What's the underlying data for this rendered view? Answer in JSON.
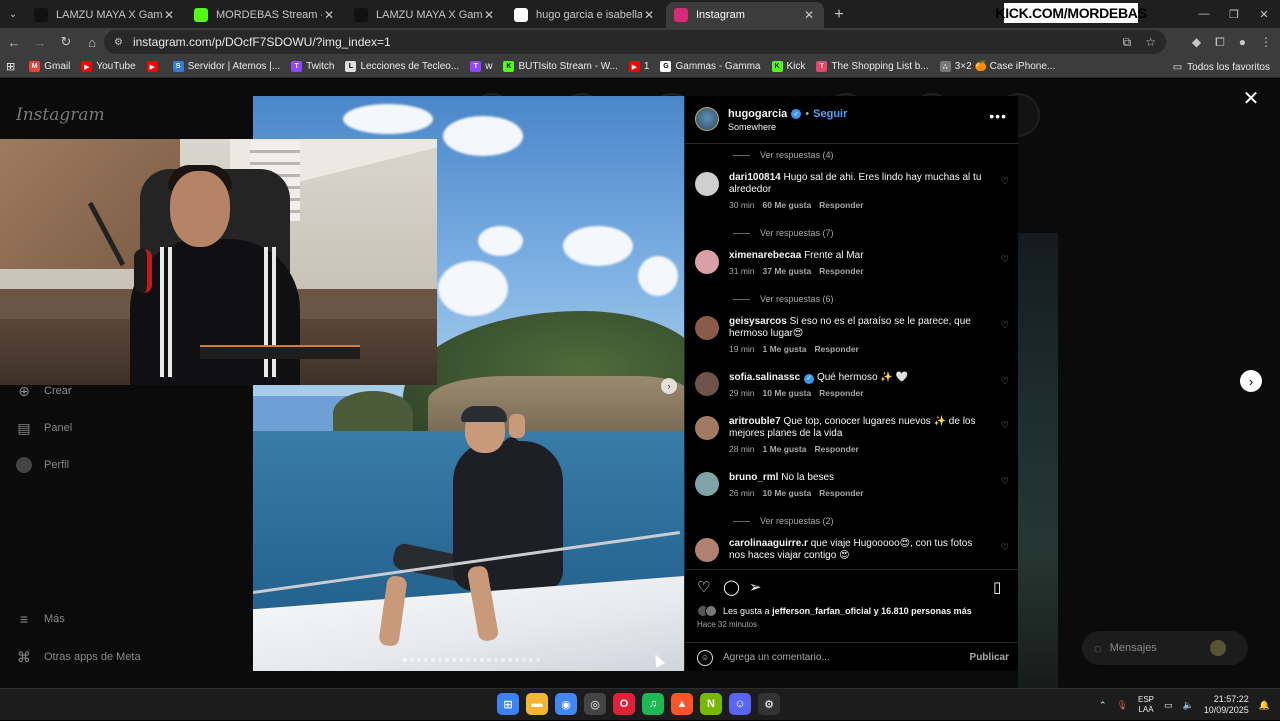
{
  "browser": {
    "tabs": [
      {
        "title": "LAMZU MAYA X Gaming Mous",
        "favicon": "tiktok-icon",
        "color": "#111111",
        "active": false
      },
      {
        "title": "MORDEBAS Stream - Watch Li",
        "favicon": "kick-icon",
        "color": "#53fc18",
        "active": false
      },
      {
        "title": "LAMZU MAYA X Gaming Mous",
        "favicon": "tiktok-icon",
        "color": "#111111",
        "active": false
      },
      {
        "title": "hugo garcia e isabella ladera - B",
        "favicon": "google-icon",
        "color": "#ffffff",
        "active": false
      },
      {
        "title": "Instagram",
        "favicon": "instagram-icon",
        "color": "#d62976",
        "active": true
      }
    ],
    "kick_overlay": "KICK.COM/MORDEBAS",
    "url": "instagram.com/p/DOcfF7SDOWU/?img_index=1",
    "bookmarks": [
      {
        "label": "Gmail",
        "color": "#ea4335",
        "glyph": "M"
      },
      {
        "label": "YouTube",
        "color": "#ff0000",
        "glyph": "▶"
      },
      {
        "label": "",
        "color": "#ff0000",
        "glyph": "▶"
      },
      {
        "label": "Servidor | Atemos |...",
        "color": "#2f7fd6",
        "glyph": "S"
      },
      {
        "label": "Twitch",
        "color": "#9146ff",
        "glyph": "T"
      },
      {
        "label": "Lecciones de Tecleo...",
        "color": "#dddddd",
        "glyph": "L"
      },
      {
        "label": "w",
        "color": "#9146ff",
        "glyph": "T"
      },
      {
        "label": "BUTIsito Stream - W...",
        "color": "#53fc18",
        "glyph": "K"
      },
      {
        "label": "1",
        "color": "#ff0000",
        "glyph": "▶"
      },
      {
        "label": "Gammas - Gamma",
        "color": "#ffffff",
        "glyph": "G"
      },
      {
        "label": "Kick",
        "color": "#53fc18",
        "glyph": "K"
      },
      {
        "label": "The Shopping List b...",
        "color": "#e8456b",
        "glyph": "T"
      },
      {
        "label": "3×2 🍊 Case iPhone...",
        "color": "#777777",
        "glyph": "∴"
      }
    ],
    "all_bookmarks": "Todos los favoritos"
  },
  "instagram": {
    "logo": "Instagram",
    "sidebar": [
      {
        "label": "Crear",
        "icon": "plus-icon",
        "glyph": "⊕"
      },
      {
        "label": "Panel",
        "icon": "chart-icon",
        "glyph": "▤"
      },
      {
        "label": "Perfil",
        "icon": "profile-icon",
        "glyph": "●"
      },
      {
        "label": "Más",
        "icon": "menu-icon",
        "glyph": "≡"
      },
      {
        "label": "Otras apps de Meta",
        "icon": "meta-icon",
        "glyph": "⌘"
      }
    ],
    "messages": "Mensajes",
    "post": {
      "username": "hugogarcia",
      "follow": "Seguir",
      "location": "Somewhere",
      "likes_prefix": "Les gusta a",
      "likes_user": "jefferson_farfan_oficial",
      "likes_conj": "y",
      "likes_count": "16.810 personas más",
      "posted": "Hace 32 minutos",
      "comment_placeholder": "Agrega un comentario...",
      "publish": "Publicar",
      "carousel_index": 1,
      "carousel_total": 20
    },
    "comments": [
      {
        "type": "replies",
        "text": "Ver respuestas (4)"
      },
      {
        "type": "comment",
        "user": "dari100814",
        "text": "Hugo sal de ahi. Eres lindo hay muchas al tu alrededor",
        "time": "30 min",
        "likes": "60 Me gusta",
        "reply": "Responder",
        "avatar": "#cfcfcf"
      },
      {
        "type": "replies",
        "text": "Ver respuestas (7)"
      },
      {
        "type": "comment",
        "user": "ximenarebecaa",
        "text": "Frente al Mar",
        "time": "31 min",
        "likes": "37 Me gusta",
        "reply": "Responder",
        "avatar": "#d9a0a8"
      },
      {
        "type": "replies",
        "text": "Ver respuestas (6)"
      },
      {
        "type": "comment",
        "user": "geisysarcos",
        "text": "Si eso no es el paraíso se le parece, que hermoso lugar😍",
        "time": "19 min",
        "likes": "1 Me gusta",
        "reply": "Responder",
        "avatar": "#8a5a4a"
      },
      {
        "type": "comment",
        "user": "sofia.salinassc",
        "text": "Qué hermoso ✨ 🤍",
        "time": "29 min",
        "likes": "10 Me gusta",
        "reply": "Responder",
        "avatar": "#6e5448",
        "verified": true
      },
      {
        "type": "comment",
        "user": "aritrouble7",
        "text": "Que top, conocer lugares nuevos ✨ de los mejores planes de la vida",
        "time": "28 min",
        "likes": "1 Me gusta",
        "reply": "Responder",
        "avatar": "#a27a62"
      },
      {
        "type": "comment",
        "user": "bruno_rml",
        "text": "No la beses",
        "time": "26 min",
        "likes": "10 Me gusta",
        "reply": "Responder",
        "avatar": "#7fa4a8"
      },
      {
        "type": "replies",
        "text": "Ver respuestas (2)"
      },
      {
        "type": "comment",
        "user": "carolinaaguirre.r",
        "text": "que viaje Hugooooo😍, con tus fotos nos haces viajar contigo 😍",
        "time": "",
        "likes": "",
        "reply": "",
        "avatar": "#b08070"
      }
    ]
  },
  "taskbar": {
    "apps": [
      {
        "name": "windows-start-icon",
        "glyph": "⊞",
        "color": "#3b82f6"
      },
      {
        "name": "file-explorer-icon",
        "glyph": "▬",
        "color": "#f2b632"
      },
      {
        "name": "chrome-icon",
        "glyph": "◉",
        "color": "#4285f4"
      },
      {
        "name": "obs-icon",
        "glyph": "◎",
        "color": "#444444"
      },
      {
        "name": "opera-icon",
        "glyph": "O",
        "color": "#e1203a"
      },
      {
        "name": "spotify-icon",
        "glyph": "♫",
        "color": "#1db954"
      },
      {
        "name": "brave-icon",
        "glyph": "▲",
        "color": "#fb542b"
      },
      {
        "name": "nvidia-icon",
        "glyph": "N",
        "color": "#76b900"
      },
      {
        "name": "discord-icon",
        "glyph": "☺",
        "color": "#5865f2"
      },
      {
        "name": "settings-icon",
        "glyph": "⚙",
        "color": "#333333"
      }
    ],
    "lang_top": "ESP",
    "lang_bottom": "LAA",
    "time": "21:57:22",
    "date": "10/09/2025"
  }
}
